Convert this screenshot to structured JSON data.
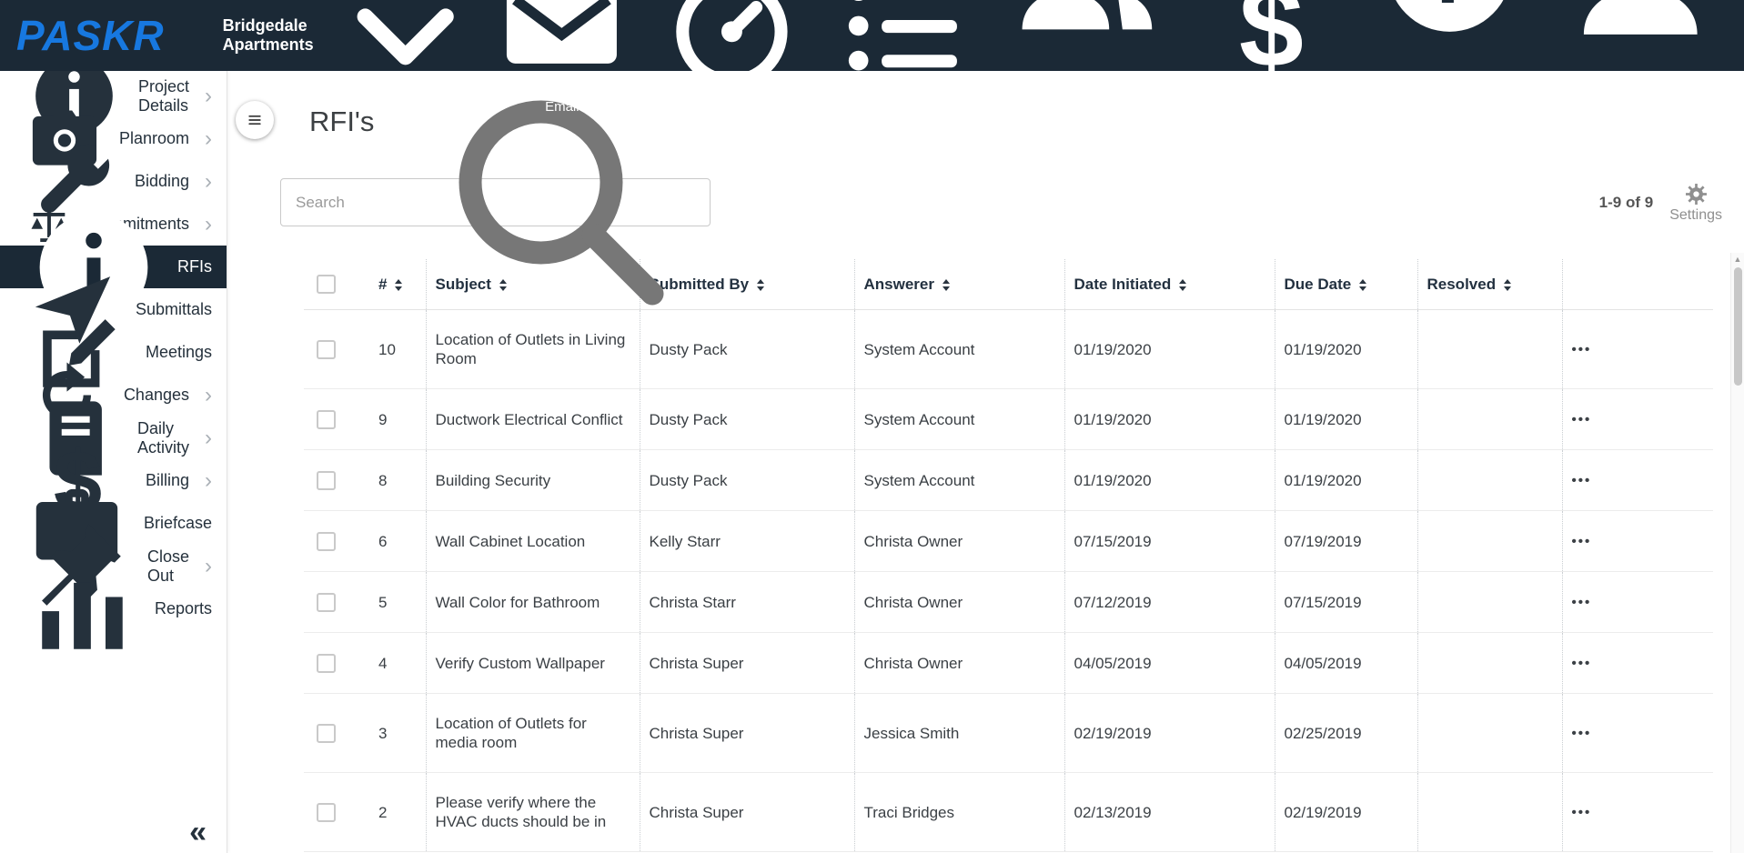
{
  "colors": {
    "topbar_bg": "#1b2936",
    "brand_blue": "#1778e0",
    "active_item_bg": "#1b2936",
    "text_dark": "#2a3540",
    "muted_gray": "#8f8f8f"
  },
  "topbar": {
    "logo": "PASKR",
    "project_selector": "Bridgedale Apartments",
    "nav": [
      {
        "label": "Email",
        "icon": "email",
        "caret": false
      },
      {
        "label": "Dashboard",
        "icon": "dashboard",
        "caret": false
      },
      {
        "label": "Projects",
        "icon": "projects",
        "caret": false
      },
      {
        "label": "Contacts",
        "icon": "contacts",
        "caret": true
      },
      {
        "label": "Accounting",
        "icon": "accounting",
        "caret": false
      },
      {
        "label": "Help",
        "icon": "help",
        "caret": true
      },
      {
        "label": "Settings",
        "icon": "user",
        "caret": true
      }
    ]
  },
  "sidebar": {
    "items": [
      {
        "label": "Project Details",
        "icon": "info",
        "chevron": true,
        "active": false
      },
      {
        "label": "Planroom",
        "icon": "camera",
        "chevron": true,
        "active": false
      },
      {
        "label": "Bidding",
        "icon": "wrench",
        "chevron": true,
        "active": false
      },
      {
        "label": "Commitments",
        "icon": "scale",
        "chevron": true,
        "active": false
      },
      {
        "label": "RFIs",
        "icon": "info",
        "chevron": false,
        "active": true
      },
      {
        "label": "Submittals",
        "icon": "send",
        "chevron": false,
        "active": false
      },
      {
        "label": "Meetings",
        "icon": "edit",
        "chevron": false,
        "active": false
      },
      {
        "label": "Changes",
        "icon": "refresh",
        "chevron": true,
        "active": false
      },
      {
        "label": "Daily Activity",
        "icon": "journal",
        "chevron": true,
        "active": false
      },
      {
        "label": "Billing",
        "icon": "dollar",
        "chevron": true,
        "active": false
      },
      {
        "label": "Briefcase",
        "icon": "briefcase",
        "chevron": false,
        "active": false
      },
      {
        "label": "Close Out",
        "icon": "pin",
        "chevron": true,
        "active": false
      },
      {
        "label": "Reports",
        "icon": "chart",
        "chevron": false,
        "active": false
      }
    ],
    "collapse_glyph": "«"
  },
  "main": {
    "title": "RFI's",
    "search": {
      "placeholder": "Search"
    },
    "pagination": "1-9 of 9",
    "settings_label": "Settings",
    "actions_glyph": "•••",
    "table": {
      "columns": [
        "#",
        "Subject",
        "Submitted By",
        "Answerer",
        "Date Initiated",
        "Due Date",
        "Resolved"
      ],
      "rows": [
        {
          "num": "10",
          "subject": "Location of Outlets in Living Room",
          "submitted_by": "Dusty Pack",
          "answerer": "System Account",
          "date_initiated": "01/19/2020",
          "due_date": "01/19/2020",
          "resolved": ""
        },
        {
          "num": "9",
          "subject": "Ductwork Electrical Conflict",
          "submitted_by": "Dusty Pack",
          "answerer": "System Account",
          "date_initiated": "01/19/2020",
          "due_date": "01/19/2020",
          "resolved": ""
        },
        {
          "num": "8",
          "subject": "Building Security",
          "submitted_by": "Dusty Pack",
          "answerer": "System Account",
          "date_initiated": "01/19/2020",
          "due_date": "01/19/2020",
          "resolved": ""
        },
        {
          "num": "6",
          "subject": "Wall Cabinet Location",
          "submitted_by": "Kelly Starr",
          "answerer": "Christa Owner",
          "date_initiated": "07/15/2019",
          "due_date": "07/19/2019",
          "resolved": ""
        },
        {
          "num": "5",
          "subject": "Wall Color for Bathroom",
          "submitted_by": "Christa Starr",
          "answerer": "Christa Owner",
          "date_initiated": "07/12/2019",
          "due_date": "07/15/2019",
          "resolved": ""
        },
        {
          "num": "4",
          "subject": "Verify Custom Wallpaper",
          "submitted_by": "Christa Super",
          "answerer": "Christa Owner",
          "date_initiated": "04/05/2019",
          "due_date": "04/05/2019",
          "resolved": ""
        },
        {
          "num": "3",
          "subject": "Location of Outlets for media room",
          "submitted_by": "Christa Super",
          "answerer": "Jessica Smith",
          "date_initiated": "02/19/2019",
          "due_date": "02/25/2019",
          "resolved": ""
        },
        {
          "num": "2",
          "subject": "Please verify where the HVAC ducts should be in",
          "submitted_by": "Christa Super",
          "answerer": "Traci Bridges",
          "date_initiated": "02/13/2019",
          "due_date": "02/19/2019",
          "resolved": ""
        }
      ]
    }
  }
}
